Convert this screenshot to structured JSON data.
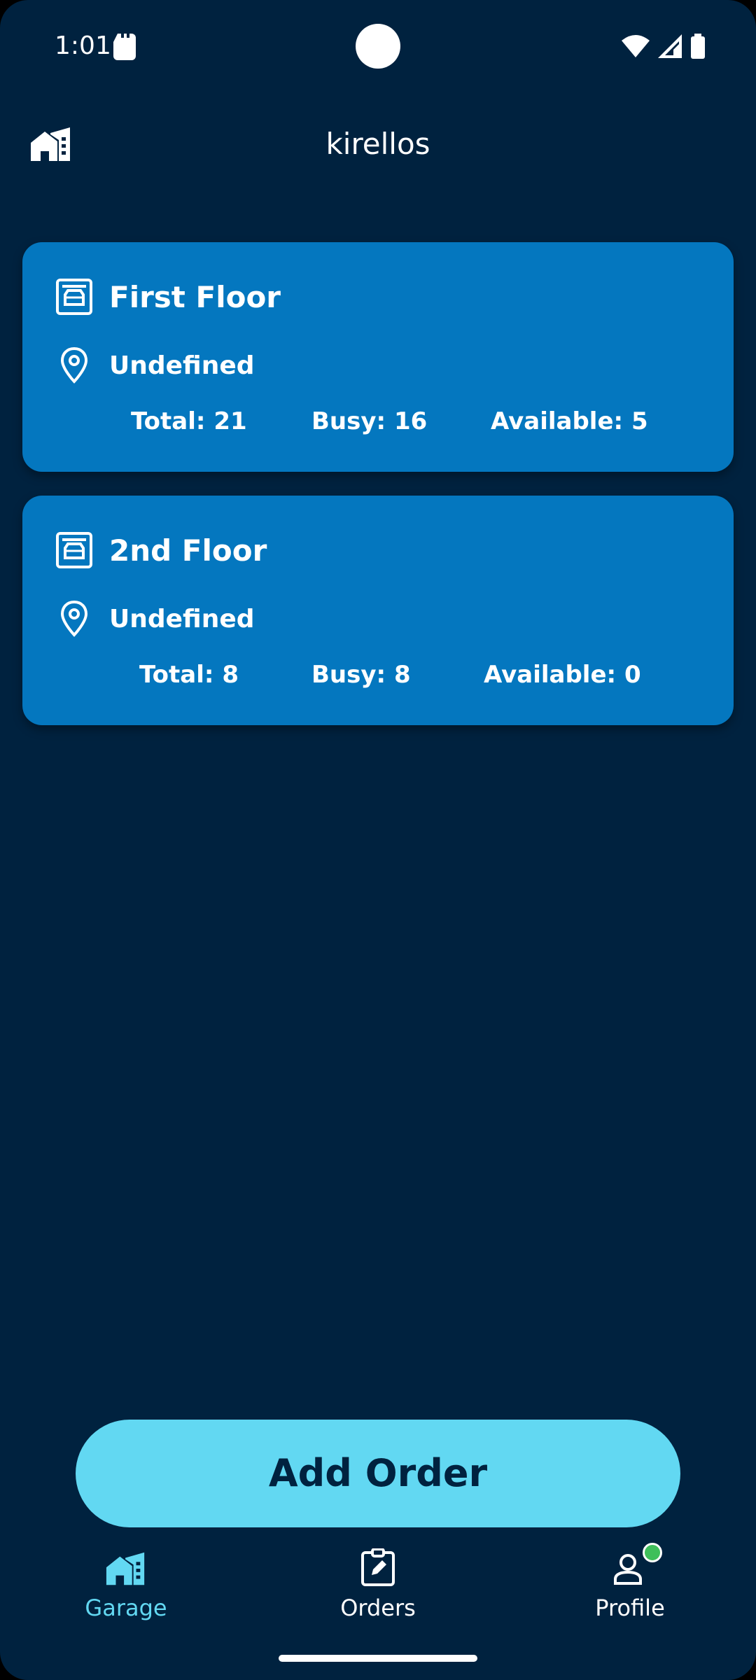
{
  "status_bar": {
    "time": "1:01"
  },
  "header": {
    "title": "kirellos"
  },
  "floors": [
    {
      "name": "First Floor",
      "location": "Undefined",
      "total": "Total: 21",
      "busy": "Busy: 16",
      "available": "Available: 5"
    },
    {
      "name": "2nd Floor",
      "location": "Undefined",
      "total": "Total: 8",
      "busy": "Busy: 8",
      "available": "Available: 0"
    }
  ],
  "actions": {
    "add_order_label": "Add Order"
  },
  "bottom_nav": {
    "items": [
      {
        "label": "Garage",
        "icon": "garage-icon",
        "active": true
      },
      {
        "label": "Orders",
        "icon": "clipboard-edit-icon",
        "active": false
      },
      {
        "label": "Profile",
        "icon": "profile-icon",
        "active": false
      }
    ]
  },
  "colors": {
    "background": "#00223f",
    "card": "#0477bf",
    "accent": "#62d8f2",
    "notification_dot": "#3fbf5a"
  }
}
